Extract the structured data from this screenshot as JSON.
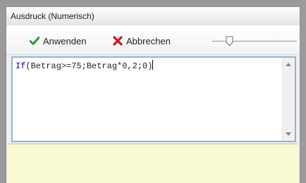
{
  "window": {
    "title": "Ausdruck (Numerisch)"
  },
  "toolbar": {
    "apply_label": "Anwenden",
    "cancel_label": "Abbrechen",
    "apply_icon": "checkmark-icon",
    "cancel_icon": "x-icon",
    "apply_color": "#2e9a2e",
    "cancel_color": "#c8161d",
    "zoom_slider_level": 0.17
  },
  "editor": {
    "keyword": "If",
    "expression": "(Betrag>=75;Betrag*0,2;0)"
  },
  "result_panel": {
    "background": "#fafad2"
  }
}
